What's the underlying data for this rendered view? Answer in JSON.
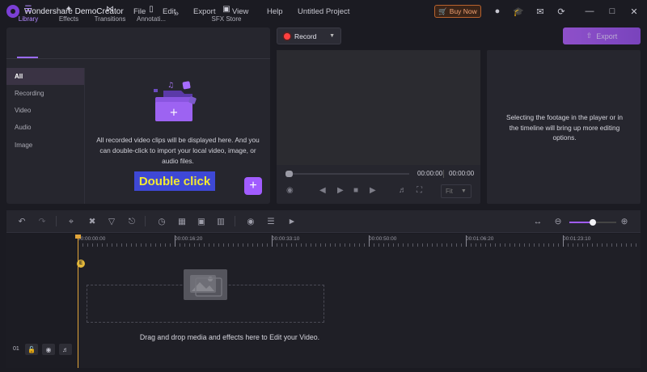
{
  "app": {
    "title": "Wondershare DemoCreator",
    "project": "Untitled Project",
    "menu": [
      "File",
      "Edit",
      "Export",
      "View",
      "Help"
    ],
    "buy_now": "Buy Now"
  },
  "library": {
    "tabs": [
      {
        "label": "Library",
        "icon": "layers-icon",
        "active": true
      },
      {
        "label": "Effects",
        "icon": "sparkle-icon",
        "active": false
      },
      {
        "label": "Transitions",
        "icon": "transition-icon",
        "active": false
      },
      {
        "label": "Annotati...",
        "icon": "annotation-icon",
        "active": false
      },
      {
        "label": "»",
        "icon": "more-icon",
        "active": false
      },
      {
        "label": "SFX Store",
        "icon": "store-icon",
        "active": false
      }
    ],
    "sidebar": [
      "All",
      "Recording",
      "Video",
      "Audio",
      "Image"
    ],
    "message": "All recorded video clips will be displayed here. And you can double-click to import your local video, image, or audio files.",
    "double_click": "Double click",
    "add_label": "+"
  },
  "player": {
    "record_label": "Record",
    "time_current": "00:00:00",
    "time_total": "00:00:00",
    "fit_label": "Fit",
    "progress": 0
  },
  "export": {
    "label": "Export"
  },
  "properties": {
    "message": "Selecting the footage in the player or in the timeline will bring up more editing options."
  },
  "timeline": {
    "ruler": [
      "00:00:00:00",
      "00:00:16:20",
      "00:00:33:10",
      "00:00:50:00",
      "00:01:06:20",
      "00:01:23:10"
    ],
    "playhead_marker": "E",
    "zoom": 0.5,
    "drop_text": "Drag and drop media and effects here to Edit your Video.",
    "track_number": "01"
  },
  "colors": {
    "accent": "#a15cff",
    "playhead": "#e2a53a",
    "record": "#ff4040"
  }
}
